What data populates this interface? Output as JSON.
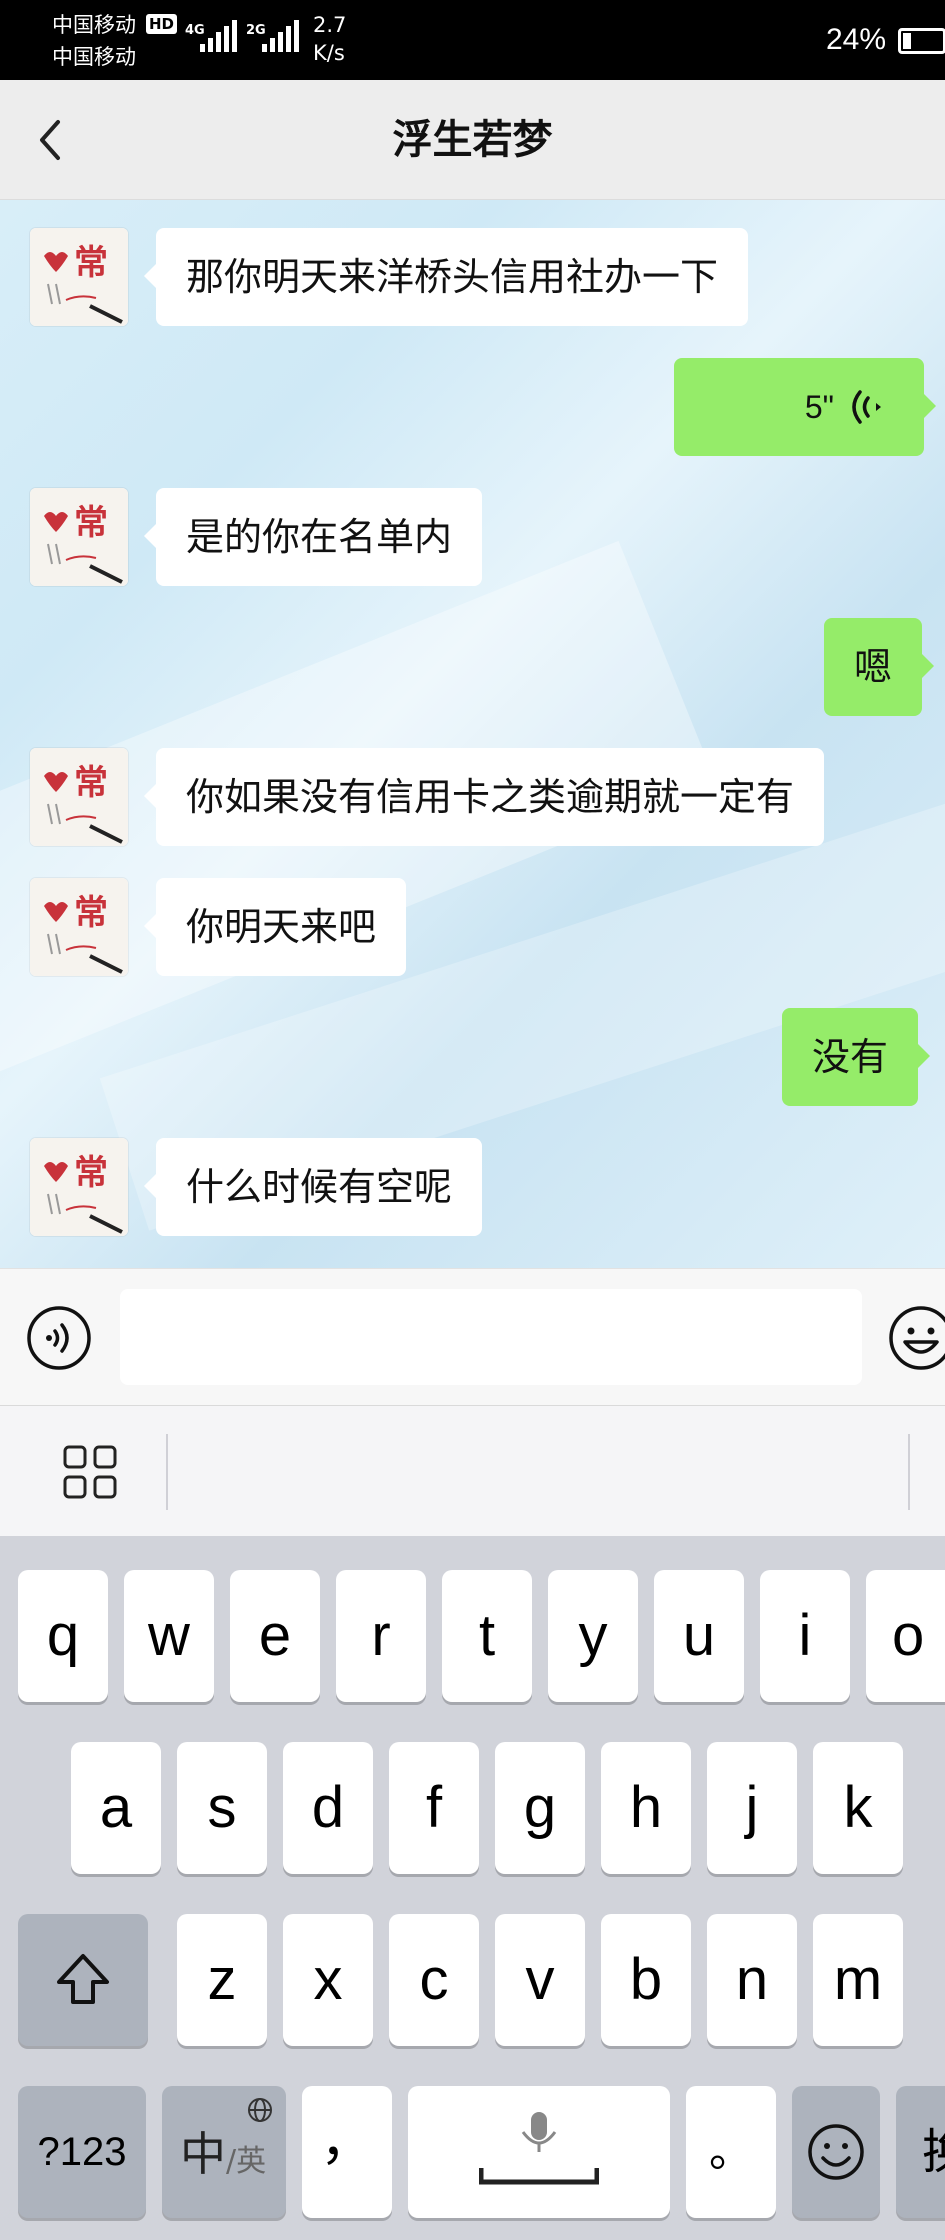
{
  "status_bar": {
    "carrier_1": "中国移动",
    "carrier_2": "中国移动",
    "hd": "HD",
    "net_1": "4G",
    "net_2": "2G",
    "speed_value": "2.7",
    "speed_unit": "K/s",
    "battery": "24%",
    "battery_level": 0.24
  },
  "nav": {
    "title": "浮生若梦",
    "back_icon": "chevron-left-icon"
  },
  "messages": [
    {
      "direction": "in",
      "type": "text",
      "text": "那你明天来洋桥头信用社办一下"
    },
    {
      "direction": "out",
      "type": "voice",
      "duration": "5\""
    },
    {
      "direction": "in",
      "type": "text",
      "text": "是的你在名单内"
    },
    {
      "direction": "out",
      "type": "text",
      "text": "嗯"
    },
    {
      "direction": "in",
      "type": "text",
      "text": "你如果没有信用卡之类逾期就一定有"
    },
    {
      "direction": "in",
      "type": "text",
      "text": "你明天来吧"
    },
    {
      "direction": "out",
      "type": "text",
      "text": "没有"
    },
    {
      "direction": "in",
      "type": "text",
      "text": "什么时候有空呢"
    }
  ],
  "input_bar": {
    "voice_icon": "voice-input-icon",
    "text_value": "",
    "emoji_icon": "emoji-icon"
  },
  "keyboard": {
    "menu_icon": "grid-menu-icon",
    "row1": [
      "q",
      "w",
      "e",
      "r",
      "t",
      "y",
      "u",
      "i",
      "o"
    ],
    "row2": [
      "a",
      "s",
      "d",
      "f",
      "g",
      "h",
      "j",
      "k"
    ],
    "row3": [
      "z",
      "x",
      "c",
      "v",
      "b",
      "n",
      "m"
    ],
    "shift_icon": "shift-icon",
    "numbers_label": "?123",
    "lang_main": "中",
    "lang_sub": "/英",
    "globe_icon": "globe-icon",
    "comma": "，",
    "space_icon": "microphone-space-icon",
    "period": "。",
    "emoji_key_icon": "emoji-icon",
    "cut_off_key": "换"
  },
  "colors": {
    "outgoing_bubble": "#95ec69",
    "incoming_bubble": "#ffffff",
    "nav_bg": "#ededed"
  }
}
